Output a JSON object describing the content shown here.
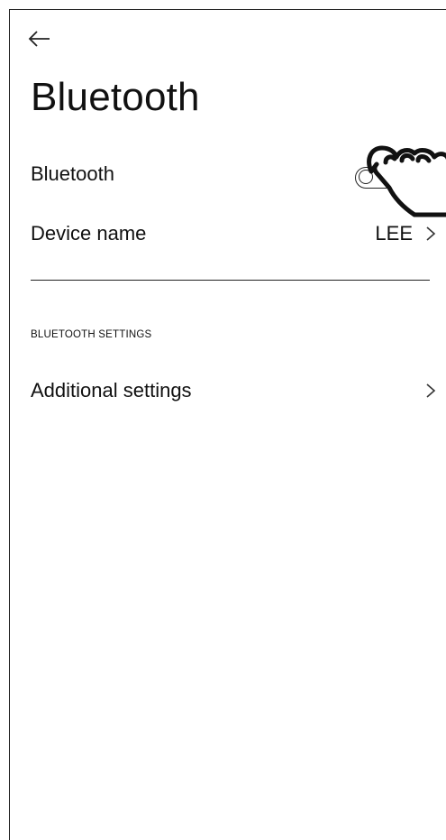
{
  "header": {
    "back_icon": "arrow-left-icon",
    "title": "Bluetooth"
  },
  "rows": {
    "bluetooth": {
      "label": "Bluetooth",
      "toggle_state": "off"
    },
    "device_name": {
      "label": "Device name",
      "value": "LEE",
      "icon": "chevron-right-icon"
    }
  },
  "section": {
    "header": "BLUETOOTH SETTINGS",
    "items": [
      {
        "label": "Additional settings",
        "icon": "chevron-right-icon"
      }
    ]
  },
  "overlay": {
    "icon": "hand-pointer-icon"
  }
}
